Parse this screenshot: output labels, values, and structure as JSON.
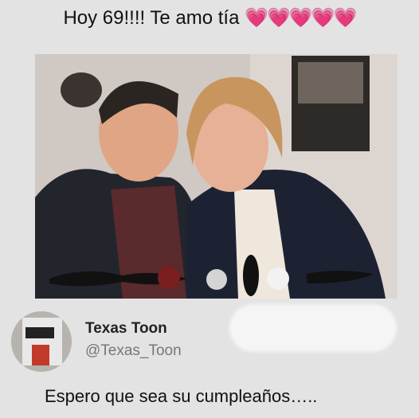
{
  "post": {
    "caption": "Hoy 69!!!! Te amo tía",
    "caption_emoji": "💗💗💗💗💗",
    "photo_description_icon": "photo-image"
  },
  "tweet": {
    "display_name": "Texas Toon",
    "handle": "@Texas_Toon",
    "text": "Espero que sea su cumpleaños….."
  },
  "colors": {
    "background": "#e3e3e3",
    "heart": "#e26bd9",
    "handle": "#777777"
  }
}
